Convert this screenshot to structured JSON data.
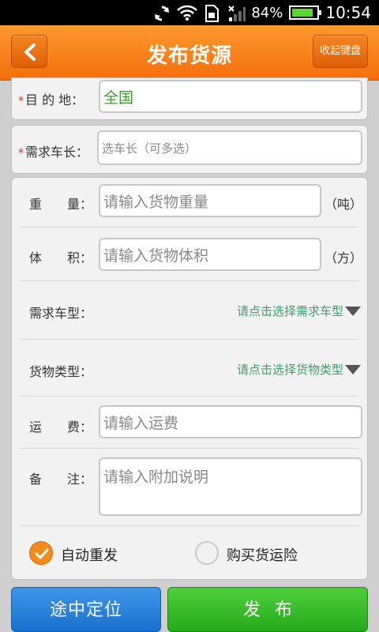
{
  "status_bar": {
    "battery": "84%",
    "battery_level": 0.84,
    "time": "10:54",
    "icons": [
      "sync-icon",
      "wifi-icon",
      "sim-icon",
      "signal-icon",
      "battery-icon"
    ]
  },
  "header": {
    "title": "发布货源",
    "back_icon": "chevron-left-icon",
    "keyboard_button": "收起键盘"
  },
  "form": {
    "destination": {
      "required_mark": "*",
      "label": "目 的 地：",
      "value": "全国"
    },
    "truck_length": {
      "required_mark": "*",
      "label": "需求车长：",
      "placeholder": "选车长（可多选）"
    },
    "weight": {
      "label": "重　　量：",
      "placeholder": "请输入货物重量",
      "unit": "（吨）"
    },
    "volume": {
      "label": "体　　积：",
      "placeholder": "请输入货物体积",
      "unit": "（方）"
    },
    "truck_type": {
      "label": "需求车型：",
      "selector": "请点击选择需求车型"
    },
    "cargo_type": {
      "label": "货物类型：",
      "selector": "请点击选择货物类型"
    },
    "freight": {
      "label": "运　　费：",
      "placeholder": "请输入运费"
    },
    "remark": {
      "label": "备　　注：",
      "placeholder": "请输入附加说明"
    },
    "auto_repost": {
      "label": "自动重发",
      "checked": true
    },
    "buy_insurance": {
      "label": "购买货运险",
      "checked": false
    }
  },
  "actions": {
    "locate": "途中定位",
    "publish": "发布"
  },
  "colors": {
    "header": "#f47a14",
    "selector_text": "#3aa06a",
    "locate_button": "#2a80dc",
    "publish_button": "#35b82a",
    "required": "#e0301e"
  }
}
